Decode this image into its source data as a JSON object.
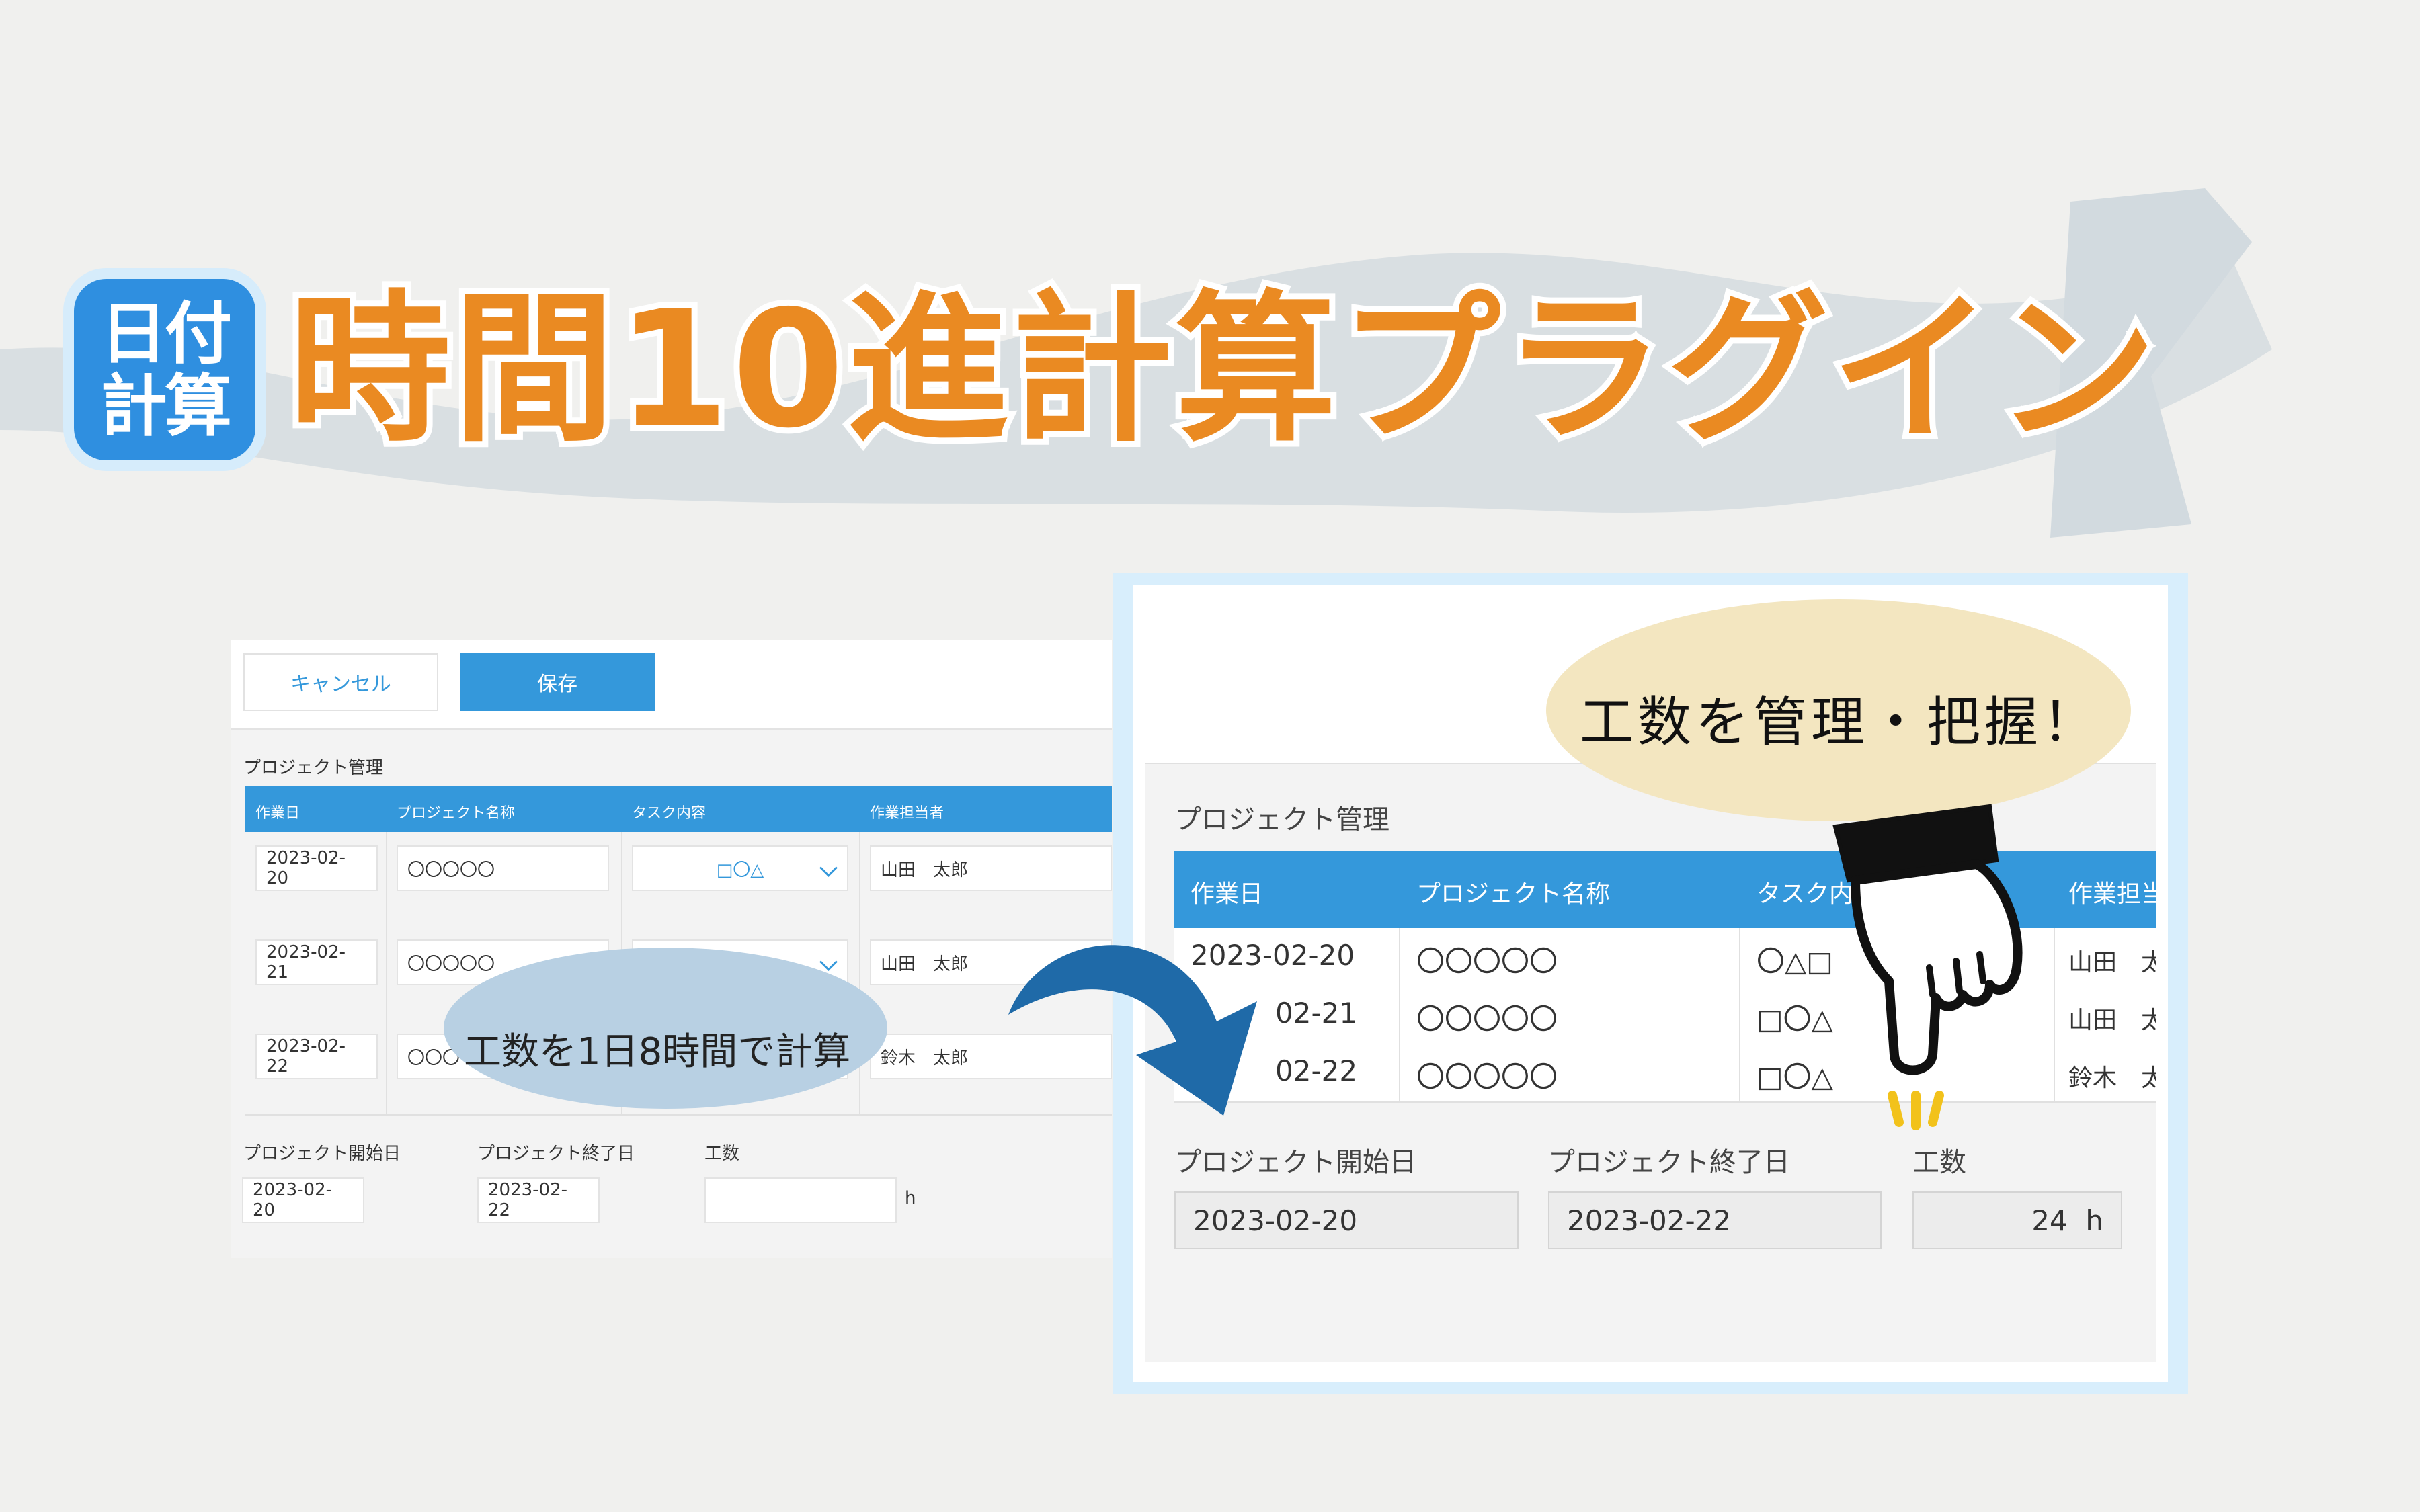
{
  "title": {
    "icon_line1": "日付",
    "icon_line2": "計算",
    "text": "時間10進計算プラグイン"
  },
  "left_form": {
    "cancel_label": "キャンセル",
    "save_label": "保存",
    "section_label": "プロジェクト管理",
    "columns": [
      "作業日",
      "プロジェクト名称",
      "タスク内容",
      "作業担当者"
    ],
    "rows": [
      {
        "date": "2023-02-20",
        "name": "〇〇〇〇〇",
        "task": "□〇△",
        "person": "山田　太郎"
      },
      {
        "date": "2023-02-21",
        "name": "〇〇〇〇〇",
        "task": "",
        "person": "山田　太郎"
      },
      {
        "date": "2023-02-22",
        "name": "〇〇〇",
        "task": "",
        "person": "鈴木　太郎"
      }
    ],
    "start_label": "プロジェクト開始日",
    "end_label": "プロジェクト終了日",
    "effort_label": "工数",
    "start_value": "2023-02-20",
    "end_value": "2023-02-22",
    "effort_value": "",
    "effort_unit": "h"
  },
  "bubble_left": "工数を1日8時間で計算",
  "bubble_right": "工数を管理・把握！",
  "right_form": {
    "section_label": "プロジェクト管理",
    "columns": [
      "作業日",
      "プロジェクト名称",
      "タスク内容",
      "作業担当"
    ],
    "rows": [
      {
        "date": "2023-02-20",
        "name": "〇〇〇〇〇",
        "task": "〇△□",
        "person": "山田　太"
      },
      {
        "date": "02-21",
        "name": "〇〇〇〇〇",
        "task": "□〇△",
        "person": "山田　太"
      },
      {
        "date": "02-22",
        "name": "〇〇〇〇〇",
        "task": "□〇△",
        "person": "鈴木　太"
      }
    ],
    "start_label": "プロジェクト開始日",
    "end_label": "プロジェクト終了日",
    "effort_label": "工数",
    "start_value": "2023-02-20",
    "end_value": "2023-02-22",
    "effort_value": "24  h"
  },
  "colors": {
    "accent_blue": "#3498db",
    "title_orange": "#ea8a22",
    "arrow_blue": "#1f6aa8",
    "bubble_yellow": "#f3e6c0",
    "bubble_blue": "#b8d0e3"
  }
}
